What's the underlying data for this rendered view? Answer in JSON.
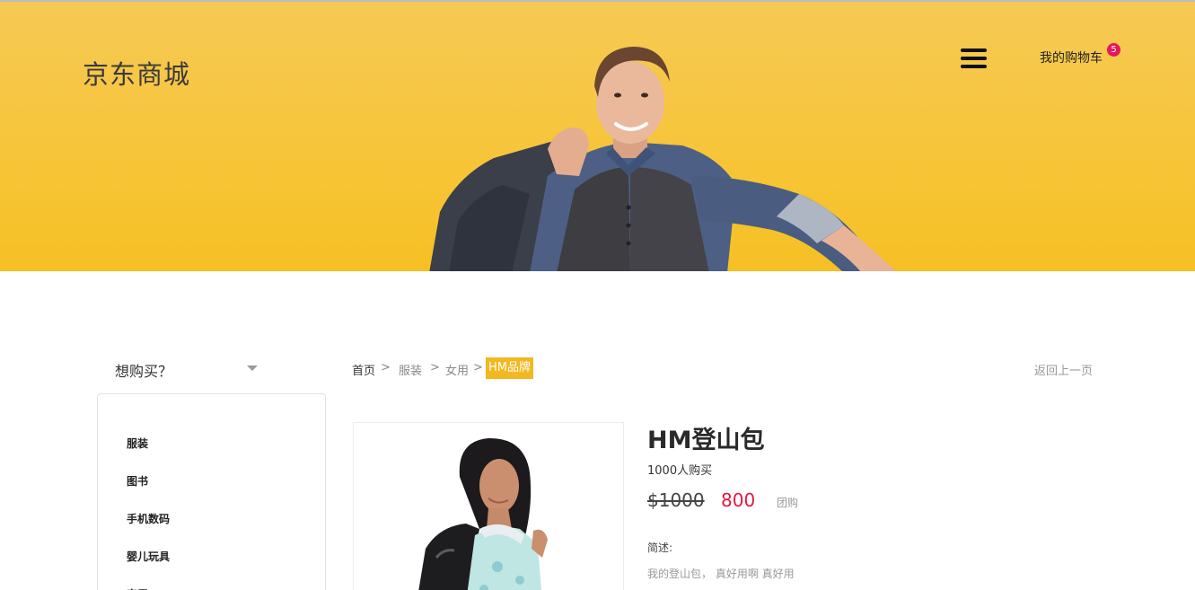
{
  "header": {
    "logo": "京东商城",
    "cart_label": "我的购物车",
    "cart_count": "5",
    "colors": {
      "banner": "#f6c530",
      "badge": "#e8175d"
    }
  },
  "sidebar": {
    "heading": "想购买？",
    "categories": [
      {
        "label": "服装"
      },
      {
        "label": "图书"
      },
      {
        "label": "手机数码"
      },
      {
        "label": "婴儿玩具"
      },
      {
        "label": "家居"
      }
    ]
  },
  "breadcrumb": {
    "items": [
      "首页",
      "服装",
      "女用"
    ],
    "separator": ">",
    "current": "HM品牌",
    "back_label": "返回上一页"
  },
  "product": {
    "title": "HM登山包",
    "buyers": "1000人购买",
    "old_price": "$1000",
    "new_price": "800",
    "group_buy": "团购",
    "desc_label": "简述:",
    "description": "我的登山包， 真好用啊 真好用",
    "colors": {
      "price": "#e5173f",
      "active_crumb": "#f3b81f"
    }
  }
}
